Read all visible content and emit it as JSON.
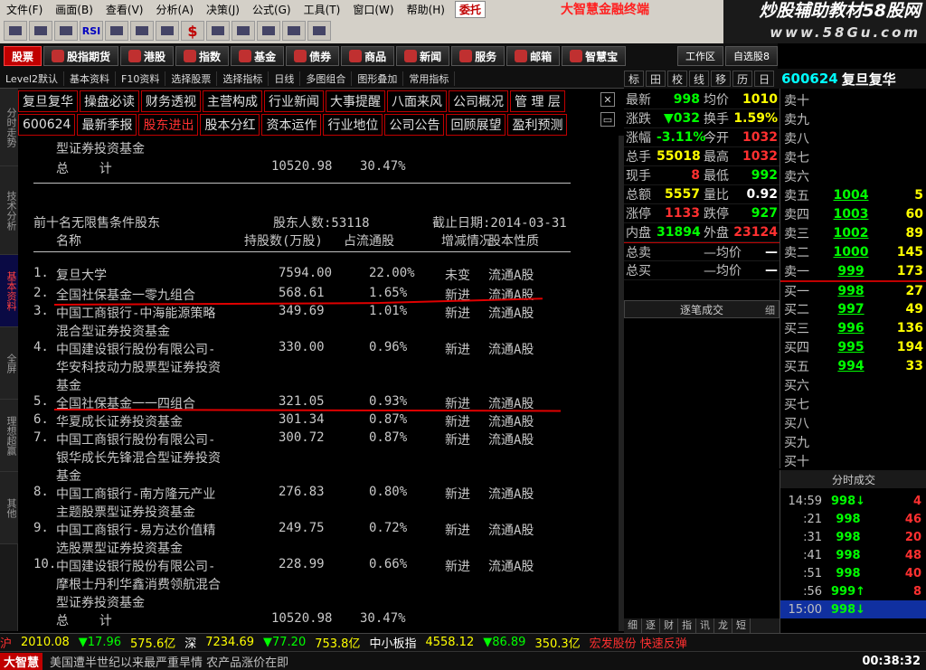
{
  "menu": {
    "items": [
      "文件(F)",
      "画面(B)",
      "查看(V)",
      "分析(A)",
      "决策(J)",
      "公式(G)",
      "工具(T)",
      "窗口(W)",
      "帮助(H)"
    ],
    "special": "委托",
    "brand": "大智慧金融终端"
  },
  "watermark": {
    "line1": "炒股辅助教材58股网",
    "line2": "www.58Gu.com"
  },
  "toolbar": {
    "icons": [
      "open-icon",
      "chart-icon",
      "kline-icon",
      "rsi-label",
      "grid-icon",
      "plus-icon",
      "ruler-icon",
      "dollar-icon",
      "finance-icon",
      "table-icon",
      "binocular-icon",
      "layout-icon",
      "coin-icon"
    ],
    "rsi": "RSI",
    "dollar": "$"
  },
  "nav": {
    "items": [
      "股票",
      "股指期货",
      "港股",
      "指数",
      "基金",
      "债券",
      "商品",
      "新闻",
      "服务",
      "邮箱",
      "智慧宝"
    ],
    "right": [
      "工作区",
      "自选股8"
    ]
  },
  "subnav": {
    "items": [
      "Level2默认",
      "基本资料",
      "F10资料",
      "选择股票",
      "选择指标",
      "日线",
      "多图组合",
      "图形叠加",
      "常用指标"
    ]
  },
  "rtop": {
    "buttons": [
      "标",
      "田",
      "校",
      "线",
      "移",
      "历",
      "日"
    ],
    "code": "600624",
    "name": "复旦复华"
  },
  "sidetabs": [
    "分时走势",
    "技术分析",
    "基本资料",
    "全屏",
    "理想超赢",
    "其他"
  ],
  "f10": {
    "row1": [
      "复旦复华",
      "操盘必读",
      "财务透视",
      "主营构成",
      "行业新闻",
      "大事提醒",
      "八面来风",
      "公司概况",
      "管 理 层"
    ],
    "row2": [
      "600624",
      "最新季报",
      "股东进出",
      "股本分红",
      "资本运作",
      "行业地位",
      "公司公告",
      "回顾展望",
      "盈利预测"
    ]
  },
  "content": {
    "top_line1": "型证券投资基金",
    "top_total_label": "总    计",
    "top_total_val": "10520.98",
    "top_total_pct": "30.47%",
    "section_title": "前十名无限售条件股东",
    "holders_label": "股东人数:53118",
    "date_label": "截止日期:2014-03-31",
    "headers": [
      "名称",
      "持股数(万股)",
      "占流通股",
      "增减情况",
      "股本性质"
    ],
    "rows": [
      {
        "no": "1.",
        "name": [
          "复旦大学"
        ],
        "shares": "7594.00",
        "pct": "22.00%",
        "change": "未变",
        "type": "流通A股"
      },
      {
        "no": "2.",
        "name": [
          "全国社保基金一零九组合"
        ],
        "shares": "568.61",
        "pct": "1.65%",
        "change": "新进",
        "type": "流通A股"
      },
      {
        "no": "3.",
        "name": [
          "中国工商银行-中海能源策略",
          "混合型证券投资基金"
        ],
        "shares": "349.69",
        "pct": "1.01%",
        "change": "新进",
        "type": "流通A股"
      },
      {
        "no": "4.",
        "name": [
          "中国建设银行股份有限公司-",
          "华安科技动力股票型证券投资",
          "基金"
        ],
        "shares": "330.00",
        "pct": "0.96%",
        "change": "新进",
        "type": "流通A股"
      },
      {
        "no": "5.",
        "name": [
          "全国社保基金一一四组合"
        ],
        "shares": "321.05",
        "pct": "0.93%",
        "change": "新进",
        "type": "流通A股"
      },
      {
        "no": "6.",
        "name": [
          "华夏成长证券投资基金"
        ],
        "shares": "301.34",
        "pct": "0.87%",
        "change": "新进",
        "type": "流通A股"
      },
      {
        "no": "7.",
        "name": [
          "中国工商银行股份有限公司-",
          "银华成长先锋混合型证券投资",
          "基金"
        ],
        "shares": "300.72",
        "pct": "0.87%",
        "change": "新进",
        "type": "流通A股"
      },
      {
        "no": "8.",
        "name": [
          "中国工商银行-南方隆元产业",
          "主题股票型证券投资基金"
        ],
        "shares": "276.83",
        "pct": "0.80%",
        "change": "新进",
        "type": "流通A股"
      },
      {
        "no": "9.",
        "name": [
          "中国工商银行-易方达价值精",
          "选股票型证券投资基金"
        ],
        "shares": "249.75",
        "pct": "0.72%",
        "change": "新进",
        "type": "流通A股"
      },
      {
        "no": "10.",
        "name": [
          "中国建设银行股份有限公司-",
          "摩根士丹利华鑫消费领航混合",
          "型证券投资基金"
        ],
        "shares": "228.99",
        "pct": "0.66%",
        "change": "新进",
        "type": "流通A股"
      }
    ],
    "bottom_total_label": "总    计",
    "bottom_total_val": "10520.98",
    "bottom_total_pct": "30.47%"
  },
  "quote": [
    {
      "l1": "最新",
      "v1": "998",
      "c1": "green",
      "l2": "均价",
      "v2": "1010",
      "c2": "yellow"
    },
    {
      "l1": "涨跌",
      "v1": "▼032",
      "c1": "green",
      "l2": "换手",
      "v2": "1.59%",
      "c2": "yellow"
    },
    {
      "l1": "涨幅",
      "v1": "-3.11%",
      "c1": "green",
      "l2": "今开",
      "v2": "1032",
      "c2": "red"
    },
    {
      "l1": "总手",
      "v1": "55018",
      "c1": "yellow",
      "l2": "最高",
      "v2": "1032",
      "c2": "red"
    },
    {
      "l1": "现手",
      "v1": "8",
      "c1": "red",
      "l2": "最低",
      "v2": "992",
      "c2": "green"
    },
    {
      "l1": "总额",
      "v1": "5557",
      "c1": "yellow",
      "l2": "量比",
      "v2": "0.92",
      "c2": "white"
    },
    {
      "l1": "涨停",
      "v1": "1133",
      "c1": "red",
      "l2": "跌停",
      "v2": "927",
      "c2": "green"
    },
    {
      "l1": "内盘",
      "v1": "31894",
      "c1": "green",
      "l2": "外盘",
      "v2": "23124",
      "c2": "red"
    },
    {
      "l1": "总卖",
      "v1": "",
      "c1": "white",
      "l2": "—均价",
      "v2": "—",
      "c2": "white"
    },
    {
      "l1": "总买",
      "v1": "",
      "c1": "white",
      "l2": "—均价",
      "v2": "—",
      "c2": "white"
    }
  ],
  "tick_title": "逐笔成交",
  "tick_more": "细",
  "btabs": [
    "细",
    "逐",
    "财",
    "指",
    "讯",
    "龙",
    "短"
  ],
  "book": [
    {
      "l": "卖十",
      "p": "",
      "pc": "white",
      "v": ""
    },
    {
      "l": "卖九",
      "p": "",
      "pc": "white",
      "v": ""
    },
    {
      "l": "卖八",
      "p": "",
      "pc": "white",
      "v": ""
    },
    {
      "l": "卖七",
      "p": "",
      "pc": "white",
      "v": ""
    },
    {
      "l": "卖六",
      "p": "",
      "pc": "white",
      "v": ""
    },
    {
      "l": "卖五",
      "p": "1004",
      "pc": "green",
      "v": "5"
    },
    {
      "l": "卖四",
      "p": "1003",
      "pc": "green",
      "v": "60"
    },
    {
      "l": "卖三",
      "p": "1002",
      "pc": "green",
      "v": "89"
    },
    {
      "l": "卖二",
      "p": "1000",
      "pc": "green",
      "v": "145"
    },
    {
      "l": "卖一",
      "p": "999",
      "pc": "green",
      "v": "173"
    },
    {
      "l": "买一",
      "p": "998",
      "pc": "green",
      "v": "27"
    },
    {
      "l": "买二",
      "p": "997",
      "pc": "green",
      "v": "49"
    },
    {
      "l": "买三",
      "p": "996",
      "pc": "green",
      "v": "136"
    },
    {
      "l": "买四",
      "p": "995",
      "pc": "green",
      "v": "194"
    },
    {
      "l": "买五",
      "p": "994",
      "pc": "green",
      "v": "33"
    },
    {
      "l": "买六",
      "p": "",
      "pc": "white",
      "v": ""
    },
    {
      "l": "买七",
      "p": "",
      "pc": "white",
      "v": ""
    },
    {
      "l": "买八",
      "p": "",
      "pc": "white",
      "v": ""
    },
    {
      "l": "买九",
      "p": "",
      "pc": "white",
      "v": ""
    },
    {
      "l": "买十",
      "p": "",
      "pc": "white",
      "v": ""
    }
  ],
  "ticks_title": "分时成交",
  "ticks": [
    {
      "t": "14:59",
      "p": "998↓",
      "v": "4",
      "vc": "red"
    },
    {
      "t": ":21",
      "p": "998",
      "v": "46",
      "vc": "red"
    },
    {
      "t": ":31",
      "p": "998",
      "v": "20",
      "vc": "red"
    },
    {
      "t": ":41",
      "p": "998",
      "v": "48",
      "vc": "red"
    },
    {
      "t": ":51",
      "p": "998",
      "v": "40",
      "vc": "red"
    },
    {
      "t": ":56",
      "p": "999↑",
      "v": "8",
      "vc": "red"
    },
    {
      "t": "15:00",
      "p": "998↓",
      "v": "",
      "vc": "red"
    }
  ],
  "status": {
    "sh": "沪",
    "sh_val": "2010.08",
    "sh_chg": "▼17.96",
    "sh_amt": "575.6亿",
    "sz": "深",
    "sz_val": "7234.69",
    "sz_chg": "▼77.20",
    "sz_amt": "753.8亿",
    "sm": "中小板指",
    "sm_val": "4558.12",
    "sm_chg": "▼86.89",
    "sm_amt": "350.3亿",
    "alert": "宏发股份 快速反弹"
  },
  "news": {
    "logo": "大智慧",
    "text": "美国遭半世纪以来最严重旱情 农产品涨价在即",
    "time": "00:38:32"
  }
}
